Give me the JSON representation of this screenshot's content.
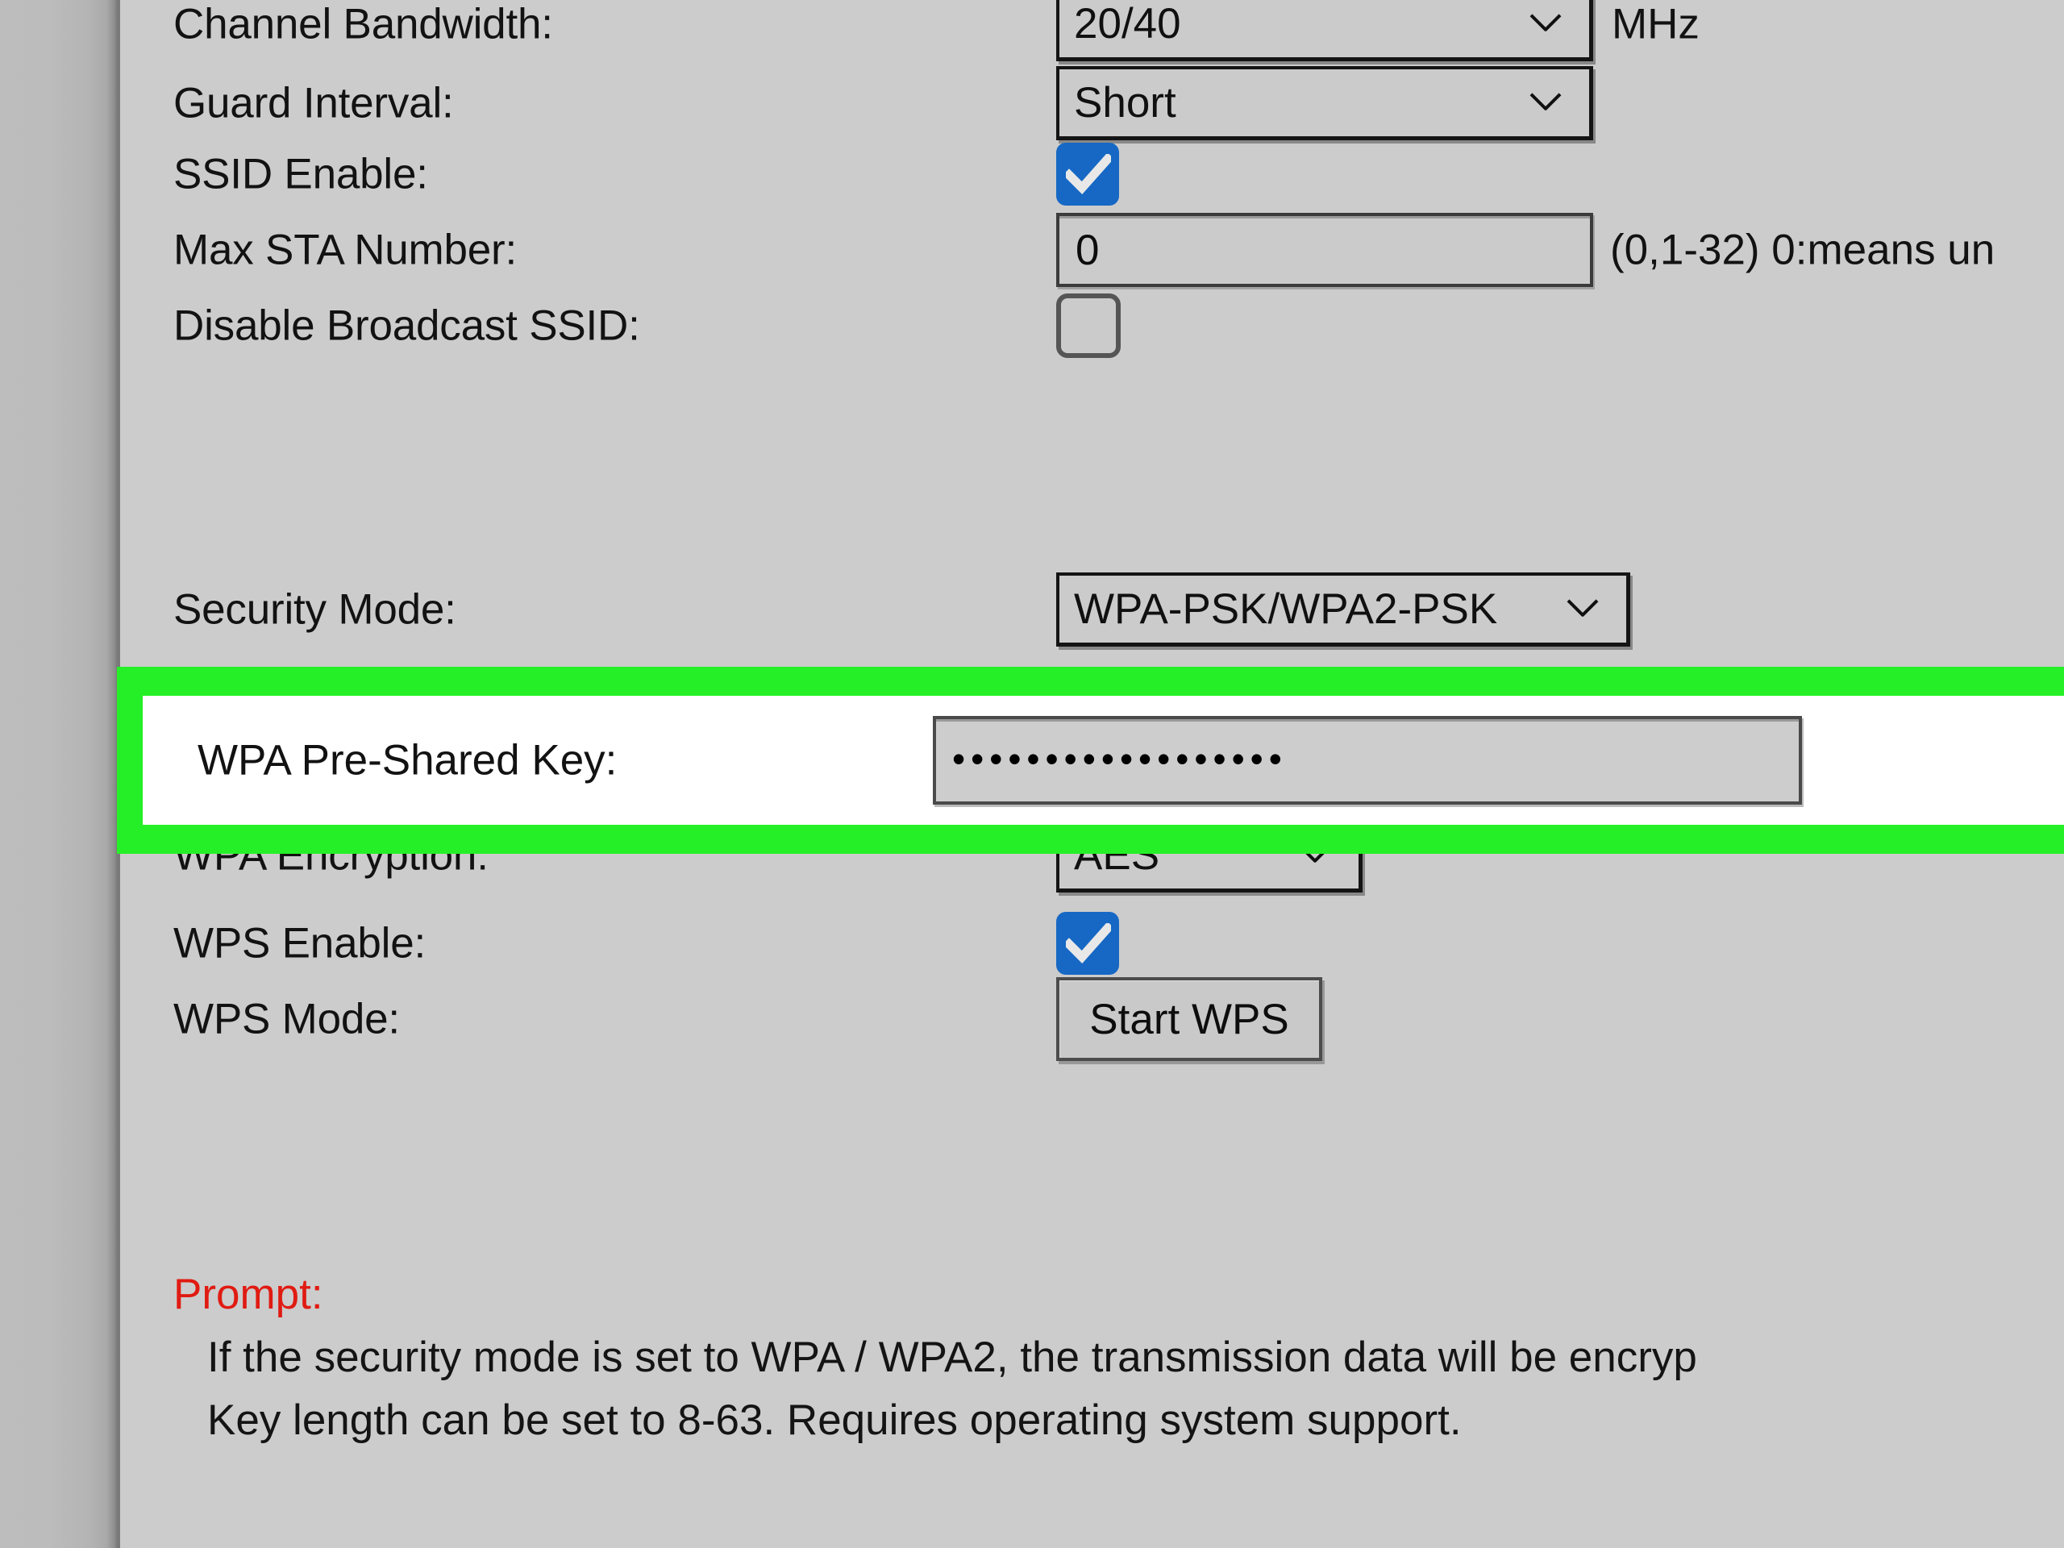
{
  "page": {
    "background_color": "#cccccc",
    "highlight_color": "#25f027",
    "checkbox_on_color": "#1668c4",
    "prompt_color": "#e01b12"
  },
  "rows": [
    {
      "label": "Channel Bandwidth:",
      "control": "select",
      "value": "20/40",
      "suffix": "MHz"
    },
    {
      "label": "Guard Interval:",
      "control": "select",
      "value": "Short",
      "suffix": ""
    },
    {
      "label": "SSID Enable:",
      "control": "checkbox_checked",
      "value": "",
      "suffix": ""
    },
    {
      "label": "Max STA Number:",
      "control": "text",
      "value": "0",
      "suffix": "(0,1-32) 0:means un"
    },
    {
      "label": "Disable Broadcast SSID:",
      "control": "checkbox_unchecked",
      "value": "",
      "suffix": ""
    },
    {
      "label": "Security Mode:",
      "control": "select",
      "value": "WPA-PSK/WPA2-PSK",
      "suffix": ""
    },
    {
      "label": "WPA Encryption:",
      "control": "select",
      "value": "AES",
      "suffix": ""
    },
    {
      "label": "WPS Enable:",
      "control": "checkbox_checked",
      "value": "",
      "suffix": ""
    },
    {
      "label": "WPS Mode:",
      "control": "button",
      "value": "Start WPS",
      "suffix": ""
    }
  ],
  "highlighted_row": {
    "label": "WPA Pre-Shared Key:",
    "value_masked": "••••••••••••••••••",
    "mask_character_count": 18
  },
  "prompt": {
    "title": "Prompt:",
    "line1": "If the security mode is set to WPA / WPA2, the transmission data will be encryp",
    "line2": "Key length can be set to 8-63. Requires operating system support."
  }
}
